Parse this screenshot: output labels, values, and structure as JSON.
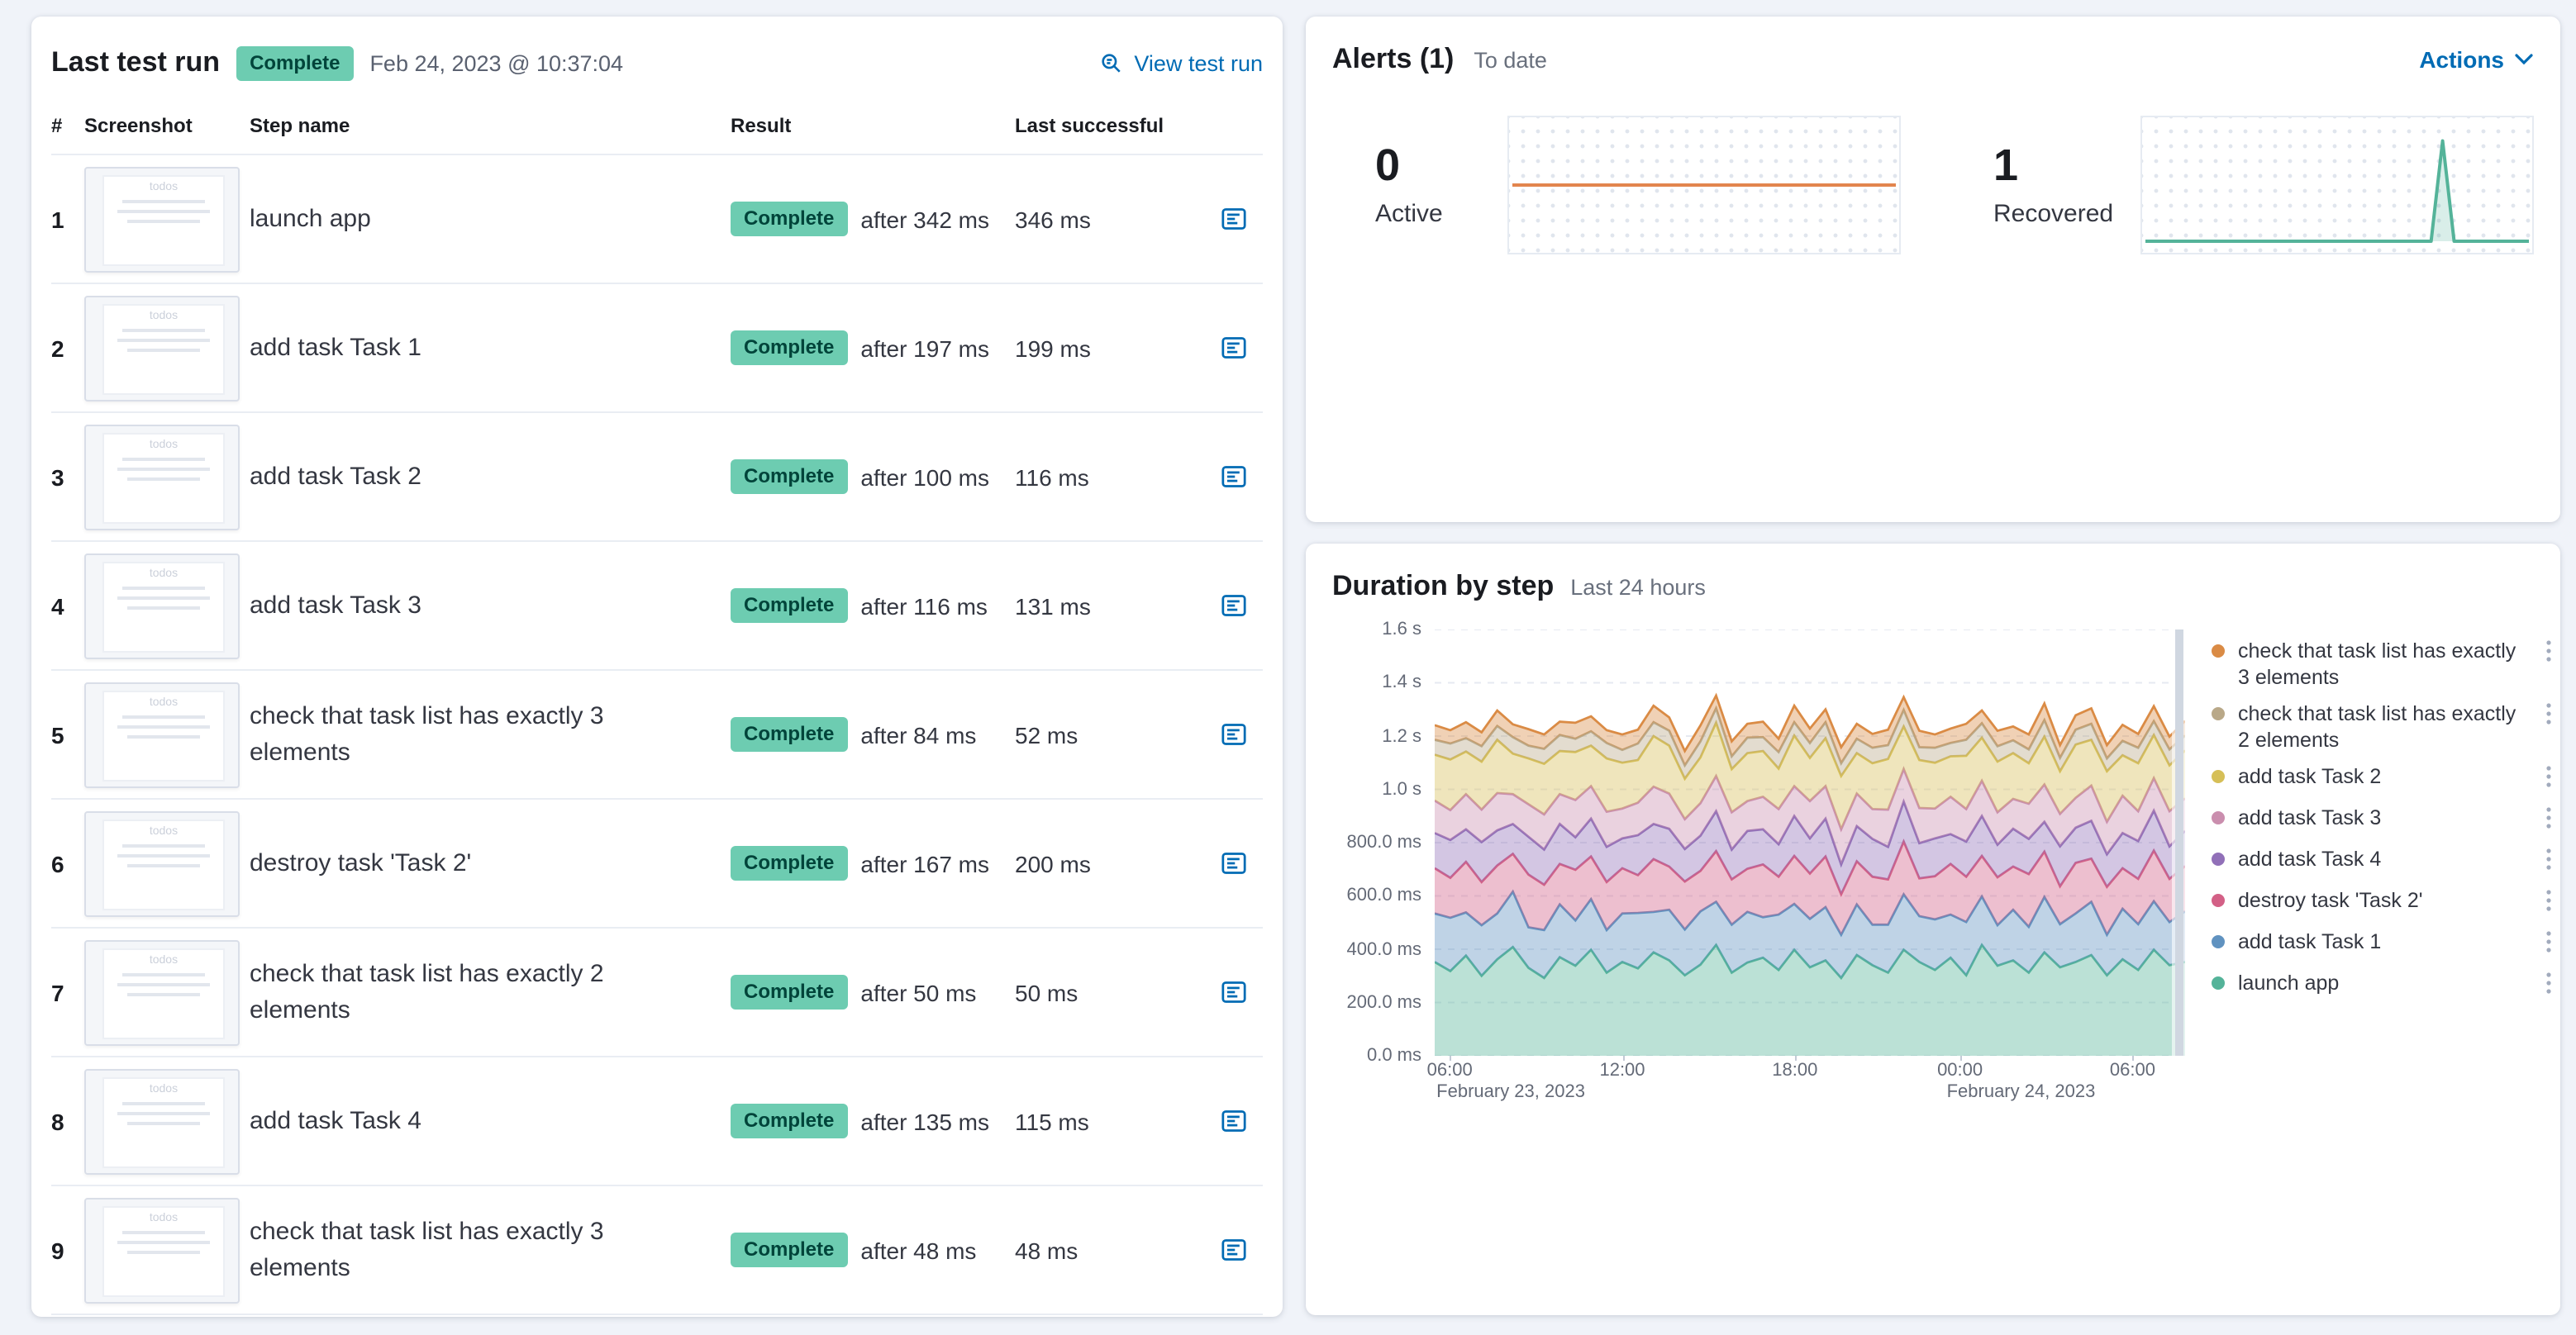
{
  "colors": {
    "success_badge_bg": "#6dccb1",
    "link": "#006BB4",
    "active_alert_line": "#e2854e",
    "recovered_alert_line": "#54B399"
  },
  "last_test_run": {
    "title": "Last test run",
    "status_badge": "Complete",
    "timestamp": "Feb 24, 2023 @ 10:37:04",
    "view_link": "View test run",
    "columns": {
      "num": "#",
      "screenshot": "Screenshot",
      "step_name": "Step name",
      "result": "Result",
      "last_successful": "Last successful"
    },
    "thumbnail_label": "todos",
    "steps": [
      {
        "num": 1,
        "name": "launch app",
        "status": "Complete",
        "after": "after 342 ms",
        "last_successful": "346 ms"
      },
      {
        "num": 2,
        "name": "add task Task 1",
        "status": "Complete",
        "after": "after 197 ms",
        "last_successful": "199 ms"
      },
      {
        "num": 3,
        "name": "add task Task 2",
        "status": "Complete",
        "after": "after 100 ms",
        "last_successful": "116 ms"
      },
      {
        "num": 4,
        "name": "add task Task 3",
        "status": "Complete",
        "after": "after 116 ms",
        "last_successful": "131 ms"
      },
      {
        "num": 5,
        "name": "check that task list has exactly 3 elements",
        "status": "Complete",
        "after": "after 84 ms",
        "last_successful": "52 ms"
      },
      {
        "num": 6,
        "name": "destroy task 'Task 2'",
        "status": "Complete",
        "after": "after 167 ms",
        "last_successful": "200 ms"
      },
      {
        "num": 7,
        "name": "check that task list has exactly 2 elements",
        "status": "Complete",
        "after": "after 50 ms",
        "last_successful": "50 ms"
      },
      {
        "num": 8,
        "name": "add task Task 4",
        "status": "Complete",
        "after": "after 135 ms",
        "last_successful": "115 ms"
      },
      {
        "num": 9,
        "name": "check that task list has exactly 3 elements",
        "status": "Complete",
        "after": "after 48 ms",
        "last_successful": "48 ms"
      }
    ]
  },
  "alerts": {
    "title": "Alerts (1)",
    "subtitle": "To date",
    "actions_label": "Actions",
    "stats": [
      {
        "value": "0",
        "label": "Active"
      },
      {
        "value": "1",
        "label": "Recovered"
      }
    ]
  },
  "duration_by_step": {
    "title": "Duration by step",
    "subtitle": "Last 24 hours"
  },
  "chart_data": [
    {
      "id": "active-alerts",
      "type": "line",
      "title": "Active alerts over time",
      "color": "#e2854e",
      "ylim": [
        -1,
        1
      ],
      "x": [
        0,
        1
      ],
      "y": [
        0,
        0
      ],
      "fill": false
    },
    {
      "id": "recovered-alerts",
      "type": "line",
      "title": "Recovered alerts over time",
      "color": "#54B399",
      "ylim": [
        0,
        1.12
      ],
      "x": [
        0,
        0.7,
        0.745,
        0.775,
        0.805,
        1
      ],
      "y": [
        0,
        0,
        0,
        1,
        0,
        0
      ],
      "fill": true
    },
    {
      "id": "duration-by-step",
      "type": "area",
      "stacked": true,
      "title": "Duration by step",
      "subtitle": "Last 24 hours",
      "ylim": [
        0,
        1600
      ],
      "y_unit": "ms",
      "grid": true,
      "legend_position": "right",
      "y_ticks": [
        {
          "v": 0,
          "label": "0.0 ms"
        },
        {
          "v": 200,
          "label": "200.0 ms"
        },
        {
          "v": 400,
          "label": "400.0 ms"
        },
        {
          "v": 600,
          "label": "600.0 ms"
        },
        {
          "v": 800,
          "label": "800.0 ms"
        },
        {
          "v": 1000,
          "label": "1.0 s"
        },
        {
          "v": 1200,
          "label": "1.2 s"
        },
        {
          "v": 1400,
          "label": "1.4 s"
        },
        {
          "v": 1600,
          "label": "1.6 s"
        }
      ],
      "x_ticks": [
        {
          "f": 0.02,
          "label": "06:00"
        },
        {
          "f": 0.25,
          "label": "12:00"
        },
        {
          "f": 0.48,
          "label": "18:00"
        },
        {
          "f": 0.7,
          "label": "00:00"
        },
        {
          "f": 0.93,
          "label": "06:00"
        }
      ],
      "x_dates": [
        {
          "f": 0.02,
          "label": "February 23, 2023"
        },
        {
          "f": 0.7,
          "label": "February 24, 2023"
        }
      ],
      "series": [
        {
          "name": "launch app",
          "color": "#54B399",
          "values": [
            352,
            318,
            376,
            300,
            362,
            408,
            330,
            292,
            370,
            338,
            398,
            312,
            352,
            328,
            388,
            358,
            302,
            342,
            416,
            312,
            350,
            368,
            322,
            398,
            332,
            358,
            292,
            378,
            340,
            312,
            398,
            352,
            322,
            368,
            302,
            416,
            338,
            358,
            312,
            388,
            332,
            352,
            378,
            302,
            362,
            322,
            398,
            340,
            352
          ]
        },
        {
          "name": "add task Task 1",
          "color": "#6092C0",
          "values": [
            182,
            200,
            162,
            190,
            172,
            208,
            152,
            180,
            198,
            170,
            190,
            160,
            182,
            208,
            152,
            190,
            172,
            200,
            162,
            180,
            190,
            152,
            208,
            172,
            182,
            200,
            162,
            190,
            152,
            180,
            208,
            172,
            190,
            162,
            200,
            182,
            152,
            190,
            172,
            208,
            162,
            182,
            200,
            152,
            190,
            172,
            182,
            162,
            190
          ]
        },
        {
          "name": "destroy task 'Task 2'",
          "color": "#D36086",
          "values": [
            170,
            150,
            190,
            162,
            180,
            142,
            198,
            170,
            152,
            190,
            160,
            180,
            170,
            142,
            198,
            162,
            180,
            152,
            190,
            170,
            162,
            198,
            142,
            180,
            170,
            190,
            152,
            162,
            180,
            170,
            198,
            142,
            162,
            190,
            170,
            152,
            180,
            162,
            198,
            170,
            142,
            190,
            162,
            180,
            152,
            170,
            190,
            162,
            170
          ]
        },
        {
          "name": "add task Task 4",
          "color": "#9170B8",
          "values": [
            132,
            142,
            122,
            150,
            132,
            112,
            142,
            132,
            150,
            122,
            142,
            132,
            112,
            150,
            132,
            142,
            122,
            132,
            150,
            112,
            142,
            132,
            122,
            150,
            132,
            142,
            112,
            132,
            142,
            122,
            150,
            132,
            142,
            112,
            132,
            150,
            122,
            142,
            132,
            112,
            150,
            132,
            142,
            122,
            132,
            142,
            150,
            122,
            132
          ]
        },
        {
          "name": "add task Task 3",
          "color": "#CA8EAE",
          "values": [
            122,
            112,
            132,
            122,
            140,
            112,
            122,
            132,
            112,
            140,
            122,
            132,
            112,
            122,
            140,
            132,
            112,
            122,
            132,
            140,
            112,
            122,
            132,
            112,
            140,
            122,
            132,
            122,
            112,
            140,
            122,
            132,
            112,
            140,
            122,
            132,
            122,
            112,
            132,
            140,
            122,
            112,
            132,
            122,
            140,
            112,
            122,
            132,
            122
          ]
        },
        {
          "name": "add task Task 2",
          "color": "#D6BF57",
          "values": [
            172,
            190,
            160,
            180,
            200,
            152,
            172,
            190,
            162,
            180,
            152,
            200,
            172,
            160,
            190,
            180,
            152,
            172,
            200,
            162,
            180,
            172,
            152,
            190,
            162,
            180,
            200,
            152,
            172,
            190,
            160,
            180,
            172,
            152,
            200,
            162,
            190,
            172,
            152,
            180,
            160,
            200,
            172,
            190,
            152,
            180,
            162,
            172,
            180
          ]
        },
        {
          "name": "check that task list has exactly 2 elements",
          "color": "#B9A888",
          "values": [
            56,
            60,
            50,
            58,
            52,
            62,
            48,
            56,
            60,
            50,
            54,
            58,
            48,
            62,
            52,
            56,
            50,
            60,
            54,
            48,
            58,
            52,
            62,
            50,
            56,
            60,
            48,
            54,
            58,
            52,
            62,
            48,
            56,
            50,
            60,
            54,
            58,
            48,
            52,
            62,
            50,
            56,
            60,
            48,
            54,
            58,
            52,
            60,
            56
          ]
        },
        {
          "name": "check that task list has exactly 3 elements",
          "color": "#DA8B45",
          "values": [
            55,
            50,
            60,
            52,
            58,
            48,
            62,
            54,
            50,
            60,
            56,
            48,
            58,
            52,
            62,
            50,
            54,
            60,
            48,
            56,
            52,
            58,
            50,
            62,
            54,
            48,
            60,
            56,
            52,
            58,
            48,
            62,
            50,
            54,
            60,
            48,
            58,
            52,
            56,
            62,
            48,
            54,
            58,
            50,
            60,
            52,
            56,
            48,
            55
          ]
        }
      ]
    }
  ]
}
